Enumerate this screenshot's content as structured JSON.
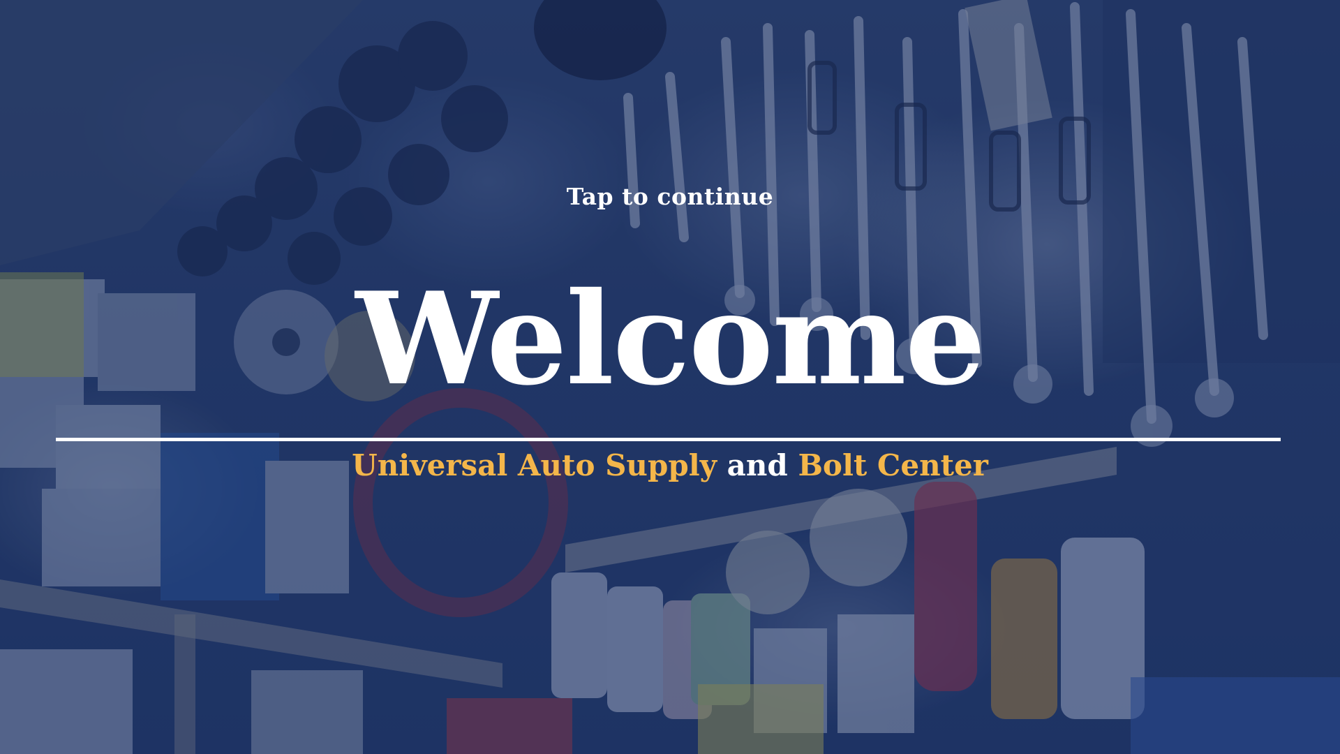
{
  "welcome_screen": {
    "tap_hint": "Tap to continue",
    "heading": "Welcome",
    "business_name_part1": "Universal Auto Supply",
    "connector": " and ",
    "business_name_part2": "Bolt Center"
  },
  "theme": {
    "overlay_color": "#1d3a7a",
    "accent_color": "#f4b64a",
    "text_color": "#ffffff"
  },
  "background_image": "auto parts store shelves with hanging wrenches, oil filters, brake fluid and engine cleaner bottles"
}
